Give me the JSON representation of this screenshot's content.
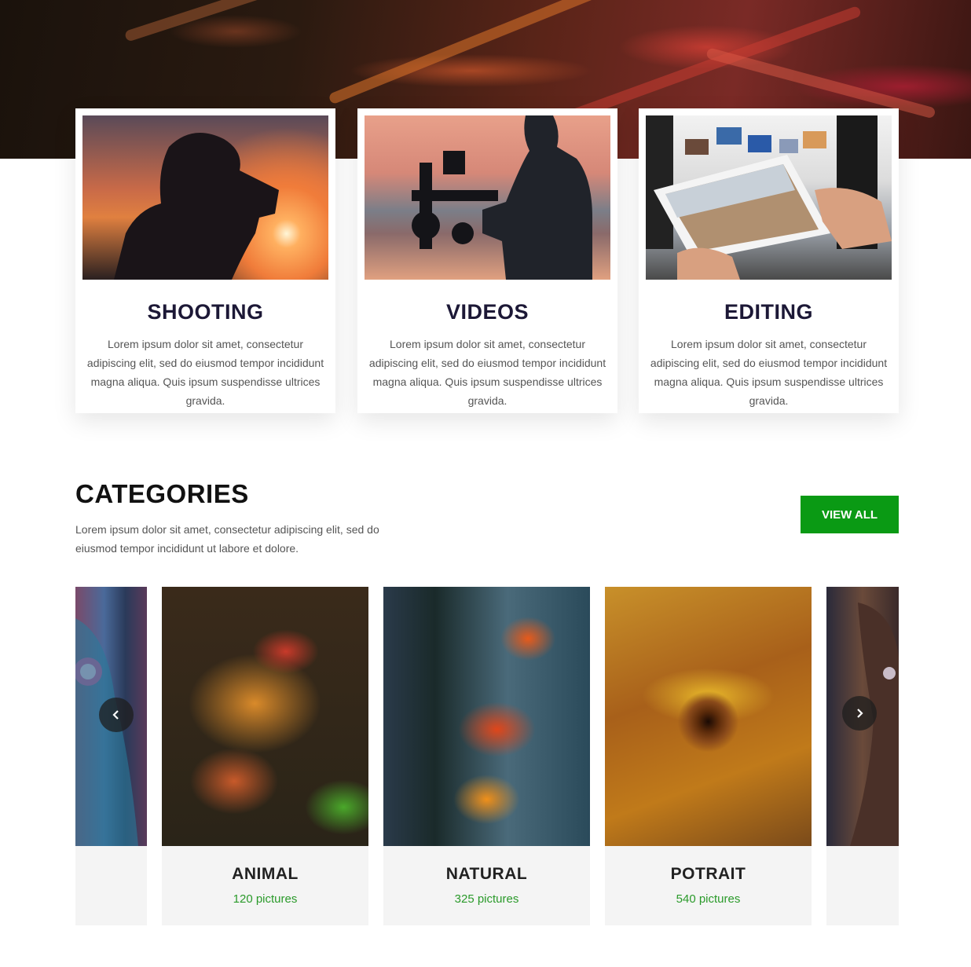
{
  "services": [
    {
      "title": "SHOOTING",
      "text": "Lorem ipsum dolor sit amet, consectetur adipiscing elit, sed do eiusmod tempor incididunt magna aliqua. Quis ipsum suspendisse ultrices gravida."
    },
    {
      "title": "VIDEOS",
      "text": "Lorem ipsum dolor sit amet, consectetur adipiscing elit, sed do eiusmod tempor incididunt magna aliqua. Quis ipsum suspendisse ultrices gravida."
    },
    {
      "title": "EDITING",
      "text": "Lorem ipsum dolor sit amet, consectetur adipiscing elit, sed do eiusmod tempor incididunt magna aliqua. Quis ipsum suspendisse ultrices gravida."
    }
  ],
  "categories": {
    "title": "CATEGORIES",
    "description": "Lorem ipsum dolor sit amet, consectetur adipiscing elit, sed do eiusmod tempor incididunt ut labore et dolore.",
    "view_all_label": "VIEW ALL",
    "items": [
      {
        "name": "ANIMAL",
        "count": "120 pictures"
      },
      {
        "name": "NATURAL",
        "count": "325 pictures"
      },
      {
        "name": "POTRAIT",
        "count": "540 pictures"
      }
    ],
    "prev_icon": "chevron-left-icon",
    "next_icon": "chevron-right-icon"
  },
  "colors": {
    "accent_green": "#0a9a14",
    "count_green": "#2a9a2a",
    "heading_navy": "#1c1836"
  }
}
